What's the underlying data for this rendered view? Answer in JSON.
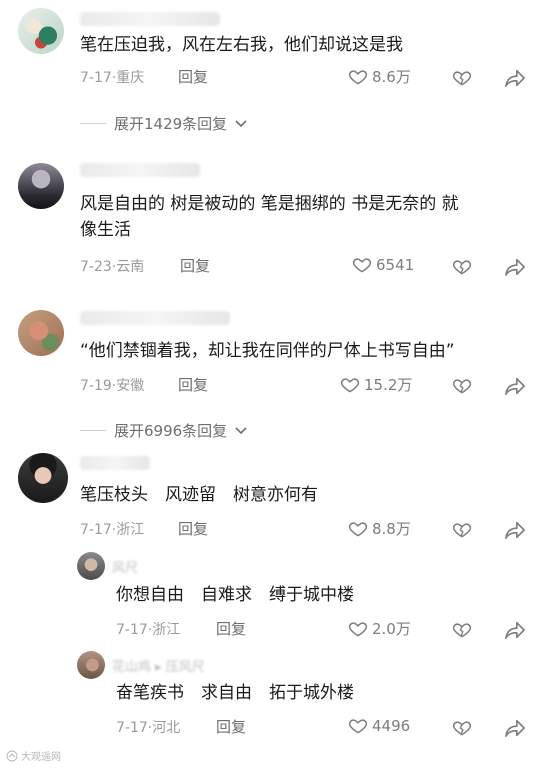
{
  "comments": [
    {
      "text": "笔在压迫我，风在左右我，他们却说这是我",
      "date_location": "7-17·重庆",
      "reply_label": "回复",
      "likes": "8.6万",
      "expand_label": "展开1429条回复"
    },
    {
      "text_line1": "风是自由的 树是被动的 笔是捆绑的 书是无奈的 就",
      "text_line2": "像生活",
      "date_location": "7-23·云南",
      "reply_label": "回复",
      "likes": "6541"
    },
    {
      "text": "“他们禁锢着我，却让我在同伴的尸体上书写自由”",
      "date_location": "7-19·安徽",
      "reply_label": "回复",
      "likes": "15.2万",
      "expand_label": "展开6996条回复"
    },
    {
      "text": "笔压枝头　风迹留　树意亦何有",
      "date_location": "7-17·浙江",
      "reply_label": "回复",
      "likes": "8.8万"
    }
  ],
  "replies": [
    {
      "name_partial": "风尺",
      "text": "你想自由　自难求　缚于城中楼",
      "date_location": "7-17·浙江",
      "reply_label": "回复",
      "likes": "2.0万"
    },
    {
      "name_partial": "花山鸡 ▸ 压风尺",
      "text": "奋笔疾书　求自由　拓于城外楼",
      "date_location": "7-17·河北",
      "reply_label": "回复",
      "likes": "4496"
    }
  ],
  "watermark": "大观遥网",
  "icons": {
    "like": "heart-outline-icon",
    "dislike": "broken-heart-icon",
    "share": "share-arrow-icon",
    "expand": "chevron-down-icon"
  },
  "colors": {
    "text": "#1a1a1a",
    "meta": "#9a9a9a",
    "action": "#6f6f6f",
    "background": "#ffffff"
  }
}
